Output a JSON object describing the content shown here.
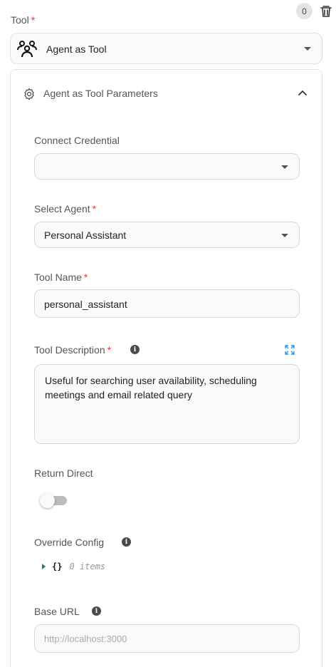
{
  "header": {
    "count_badge": "0",
    "tool_label": "Tool",
    "required_mark": "*"
  },
  "tool_select": {
    "value": "Agent as Tool"
  },
  "panel": {
    "title": "Agent as Tool Parameters",
    "fields": {
      "connect_credential": {
        "label": "Connect Credential",
        "value": ""
      },
      "select_agent": {
        "label": "Select Agent",
        "required": "*",
        "value": "Personal Assistant"
      },
      "tool_name": {
        "label": "Tool Name",
        "required": "*",
        "value": "personal_assistant"
      },
      "tool_description": {
        "label": "Tool Description",
        "required": "*",
        "value": "Useful for searching user availability, scheduling meetings and email related query"
      },
      "return_direct": {
        "label": "Return Direct",
        "checked": false
      },
      "override_config": {
        "label": "Override Config",
        "brace": "{}",
        "count": "0 items"
      },
      "base_url": {
        "label": "Base URL",
        "placeholder": "http://localhost:3000"
      }
    }
  },
  "icons": {
    "info": "info-icon",
    "trash": "trash-icon",
    "gear": "gear-icon",
    "expand": "expand-icon",
    "agent": "agent-group-icon"
  },
  "colors": {
    "required": "#e53935",
    "expand_accent": "#2196f3",
    "json_accent": "#1c7f6b"
  }
}
